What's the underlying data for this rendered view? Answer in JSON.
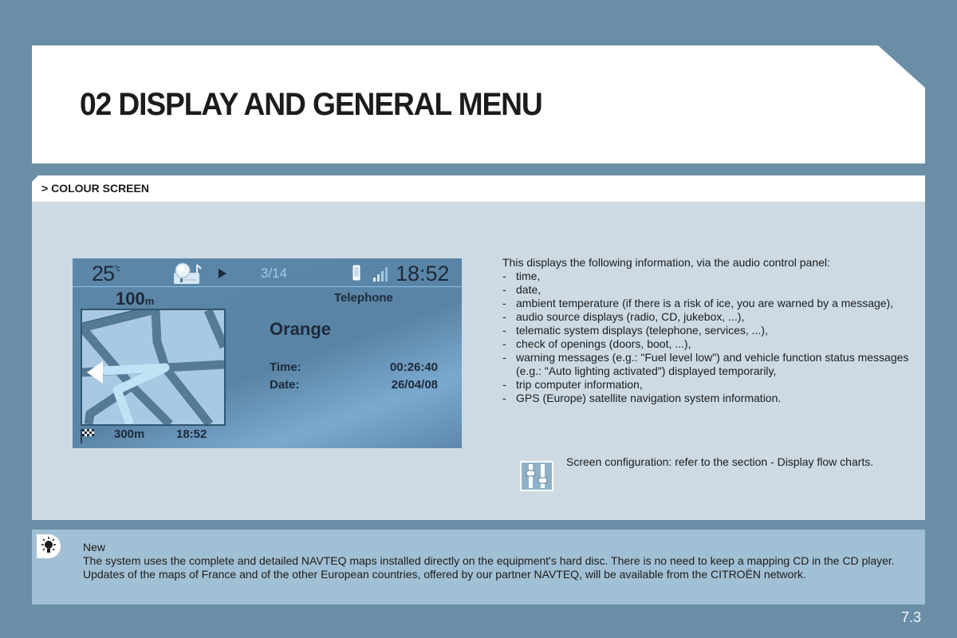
{
  "header": {
    "title": "02 DISPLAY AND GENERAL MENU",
    "section": "> COLOUR SCREEN"
  },
  "display_screen": {
    "temperature_value": "25",
    "temperature_unit": "°c",
    "track": "3/14",
    "clock": "18:52",
    "turn_distance_value": "100",
    "turn_distance_unit": "m",
    "context_title": "Telephone",
    "operator": "Orange",
    "time_label": "Time:",
    "time_value": "00:26:40",
    "date_label": "Date:",
    "date_value": "26/04/08",
    "remaining_distance": "300m",
    "arrival_time": "18:52",
    "icons": [
      "thermometer-free-temp",
      "music-source-icon",
      "play-icon",
      "phone-icon",
      "signal-strength-icon",
      "finish-flag-icon"
    ]
  },
  "intro": {
    "lead": "This displays the following information, via the audio control panel:",
    "items": [
      "time,",
      "date,",
      "ambient temperature (if there is a risk of ice, you are warned by a message),",
      "audio source displays (radio, CD, jukebox, ...),",
      "telematic system displays (telephone, services, ...),",
      "check of openings (doors, boot, ...),",
      "warning messages (e.g.: \"Fuel level low\") and vehicle function status messages (e.g.: \"Auto lighting activated\") displayed temporarily,",
      "trip computer information,",
      "GPS (Europe) satellite navigation system information."
    ]
  },
  "config": {
    "text": "Screen configuration: refer to the section - Display flow charts."
  },
  "note": {
    "title": "New",
    "body": "The system uses the complete and detailed NAVTEQ maps installed directly on the equipment's hard disc. There is no need to keep a mapping CD in the CD player. Updates of the maps of France and of the other European countries, offered by our partner NAVTEQ, will be available from the CITROËN network."
  },
  "footer": {
    "page_number": "7.3"
  },
  "colors": {
    "page_background": "#6a8ea6",
    "content_panel": "#cddae4",
    "note_panel": "#a2c0d5",
    "screen_background": "#5d87a8",
    "map_background": "#a9c9e2",
    "road": "#557a96",
    "route": "#bfe3f5"
  }
}
